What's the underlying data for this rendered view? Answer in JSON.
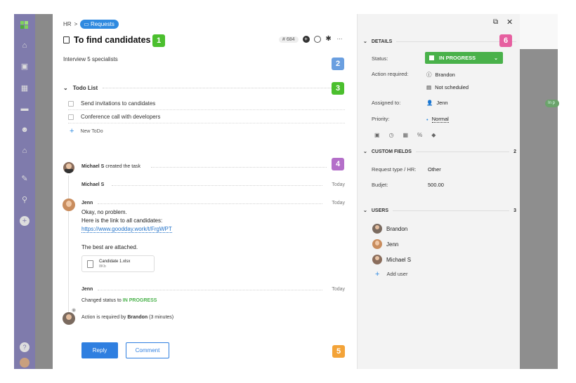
{
  "rail": {
    "icons": [
      "home-icon",
      "briefcase-icon",
      "grid-icon",
      "chat-icon",
      "people-icon",
      "bank-icon",
      "wand-icon",
      "search-icon",
      "add-icon",
      "help-icon",
      "avatar"
    ]
  },
  "breadcrumb": {
    "parent": "HR",
    "sep": ">",
    "current": "Requests"
  },
  "task": {
    "title": "To find candidates",
    "id": "# 684",
    "description": "Interview 5 specialists"
  },
  "todo": {
    "header": "Todo List",
    "items": [
      "Send invitations to candidates",
      "Conference call with developers"
    ],
    "new_label": "New ToDo"
  },
  "activity": {
    "created_by": "Michael S",
    "created_text": "created the task",
    "michael_name": "Michael S",
    "michael_date": "Today",
    "jenn_name": "Jenn",
    "jenn_date": "Today",
    "msg_line1": "Okay, no problem.",
    "msg_line2": "Here is the link to all candidates:",
    "msg_link": "https://www.goodday.work/t/FrgWPT",
    "msg_line3": "The best are attached.",
    "file_name": "Candidate 1.xlsx",
    "file_size": "8Kb",
    "jenn2_name": "Jenn",
    "jenn2_date": "Today",
    "status_prefix": "Changed status to",
    "status_value": "IN PROGRESS",
    "action_prefix": "Action is required by",
    "action_user": "Brandon",
    "action_suffix": "(3 minutes)"
  },
  "buttons": {
    "reply": "Reply",
    "comment": "Comment"
  },
  "markers": [
    "1",
    "2",
    "3",
    "4",
    "5",
    "6"
  ],
  "details": {
    "header": "DETAILS",
    "status_label": "Status:",
    "status_value": "IN PROGRESS",
    "action_label": "Action required:",
    "action_user": "Brandon",
    "action_date": "Not scheduled",
    "assigned_label": "Assigned to:",
    "assigned_value": "Jenn",
    "priority_label": "Priority:",
    "priority_value": "Normal"
  },
  "custom_fields": {
    "header": "CUSTOM FIELDS",
    "count": "2",
    "rows": [
      {
        "label": "Request type / HR:",
        "value": "Other"
      },
      {
        "label": "Budjet:",
        "value": "500.00"
      }
    ]
  },
  "users": {
    "header": "USERS",
    "count": "3",
    "list": [
      "Brandon",
      "Jenn",
      "Michael S"
    ],
    "add_label": "Add user"
  },
  "bg_right": {
    "badge": "In p"
  },
  "colors": {
    "accent": "#2f8ae0",
    "green": "#49b14a",
    "marker_green": "#4bbf2e",
    "marker_blue": "#6a9fe0",
    "marker_purple": "#b46fc9",
    "marker_orange": "#f3a338",
    "marker_pink": "#e65fa0",
    "rail": "#7f7bac"
  }
}
